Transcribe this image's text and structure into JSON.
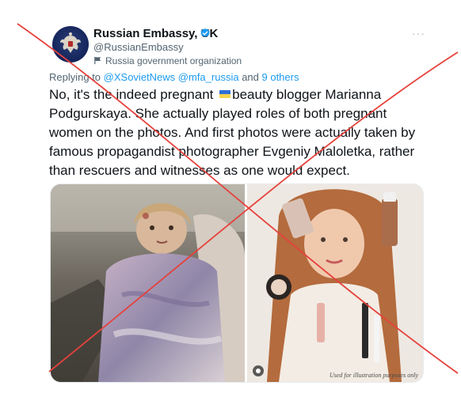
{
  "tweet": {
    "author_name": "Russian Embassy, UK",
    "author_handle": "@RussianEmbassy",
    "label_text": "Russia government organization",
    "more_glyph": "···",
    "reply_prefix": "Replying to ",
    "reply_mention_1": "@XSovietNews",
    "reply_mention_2": "@mfa_russia",
    "reply_and": " and ",
    "reply_others": "9 others",
    "text_lines": [
      [
        "No, it's the indeed pregnant ",
        "beauty blogger Marianna"
      ],
      "Podgurskaya. She actually played roles of both pregnant",
      "women on the photos. And first photos were actually taken by",
      "famous propagandist photographer Evgeniy Maloletka, rather",
      "than rescuers and witnesses as one would expect."
    ],
    "media": {
      "left_photo_icon": "woman-in-blanket-photo",
      "right_photo_icon": "beauty-blogger-photo",
      "caption": "Used for illustration purposes only"
    }
  },
  "colors": {
    "text": "#0f1419",
    "secondary": "#536471",
    "link": "#1d9bf0",
    "verified": "#1d9bf0",
    "cross_line": "#e5423c"
  }
}
